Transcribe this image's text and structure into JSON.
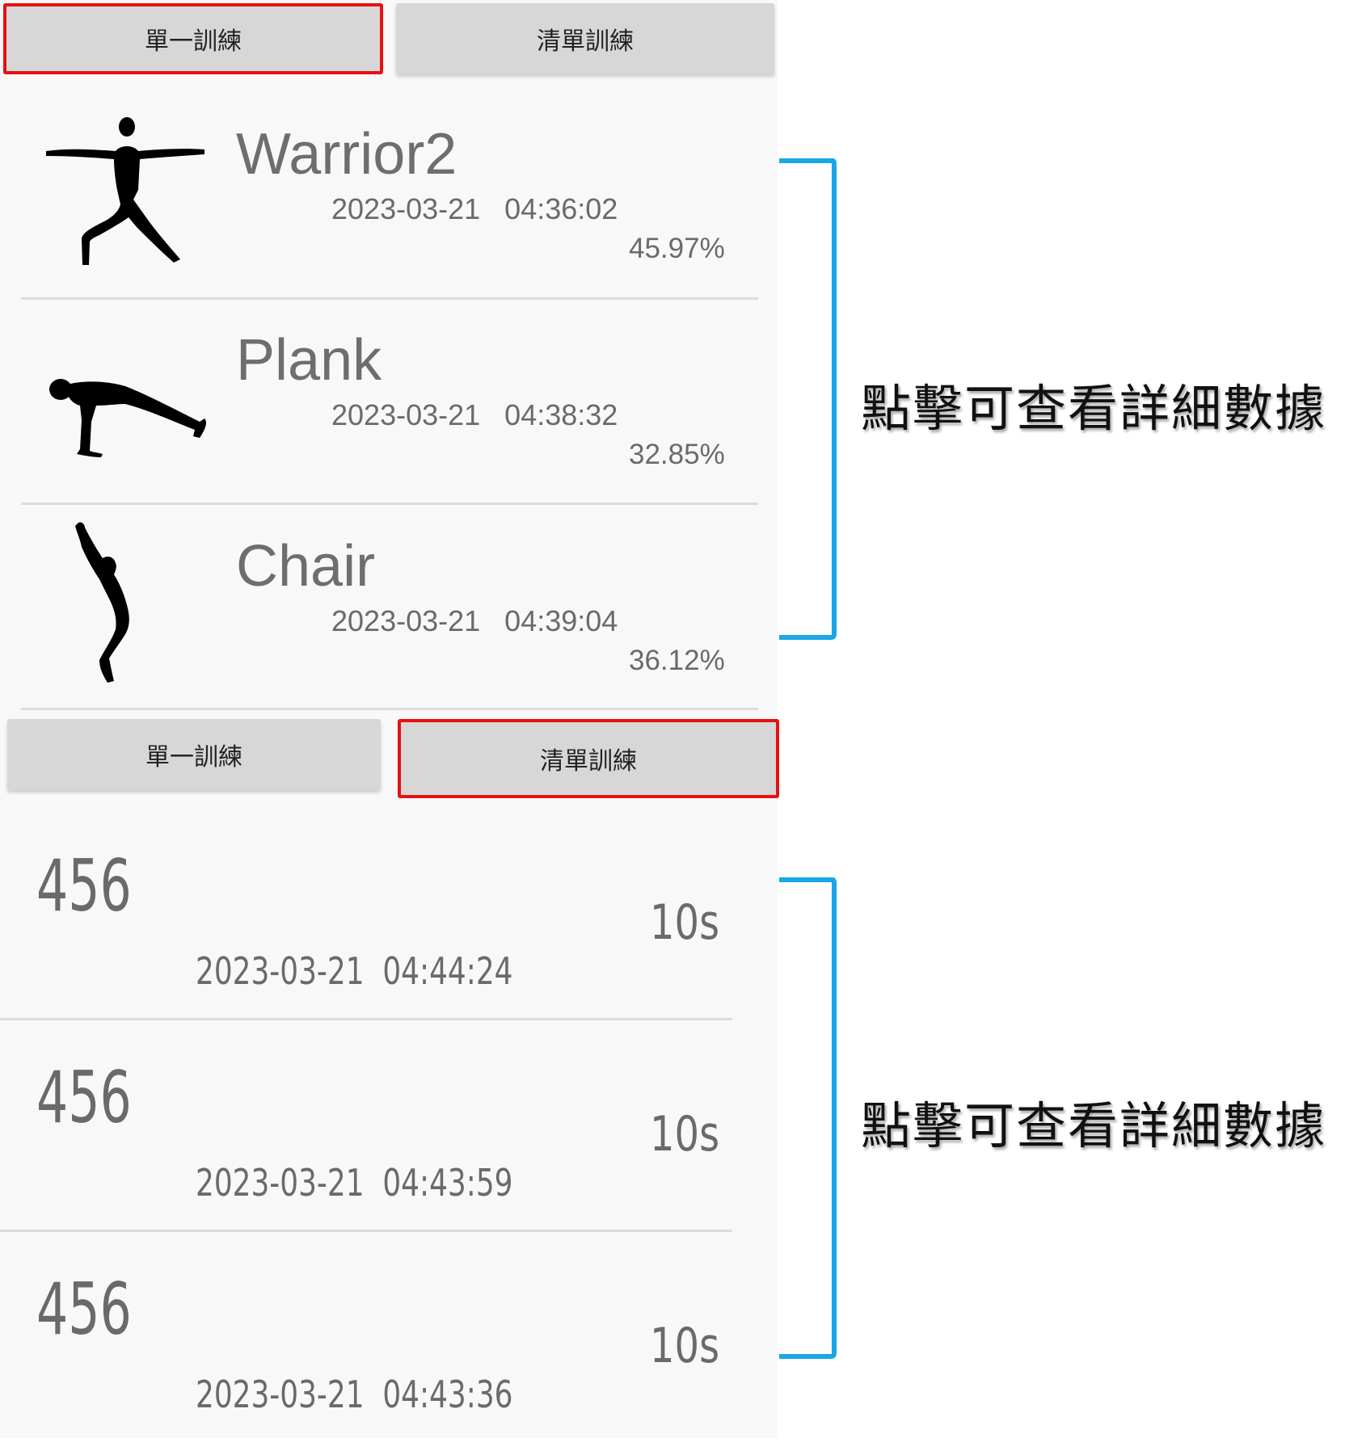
{
  "top_screen": {
    "tabs": [
      {
        "label": "單一訓練",
        "selected": true
      },
      {
        "label": "清單訓練",
        "selected": false
      }
    ],
    "records": [
      {
        "pose": "Warrior2",
        "icon": "warrior-pose-icon",
        "date": "2023-03-21",
        "time": "04:36:02",
        "score": "45.97%"
      },
      {
        "pose": "Plank",
        "icon": "plank-pose-icon",
        "date": "2023-03-21",
        "time": "04:38:32",
        "score": "32.85%"
      },
      {
        "pose": "Chair",
        "icon": "chair-pose-icon",
        "date": "2023-03-21",
        "time": "04:39:04",
        "score": "36.12%"
      }
    ]
  },
  "bottom_screen": {
    "tabs": [
      {
        "label": "單一訓練",
        "selected": false
      },
      {
        "label": "清單訓練",
        "selected": true
      }
    ],
    "records": [
      {
        "name": "456",
        "duration": "10s",
        "date": "2023-03-21",
        "time": "04:44:24"
      },
      {
        "name": "456",
        "duration": "10s",
        "date": "2023-03-21",
        "time": "04:43:59"
      },
      {
        "name": "456",
        "duration": "10s",
        "date": "2023-03-21",
        "time": "04:43:36"
      }
    ]
  },
  "annotations": {
    "top": "點擊可查看詳細數據",
    "bottom": "點擊可查看詳細數據"
  },
  "colors": {
    "highlight": "#e81010",
    "bracket": "#1aa7e6",
    "tab_bg": "#d7d7d7",
    "screen_bg": "#f8f8f8"
  }
}
